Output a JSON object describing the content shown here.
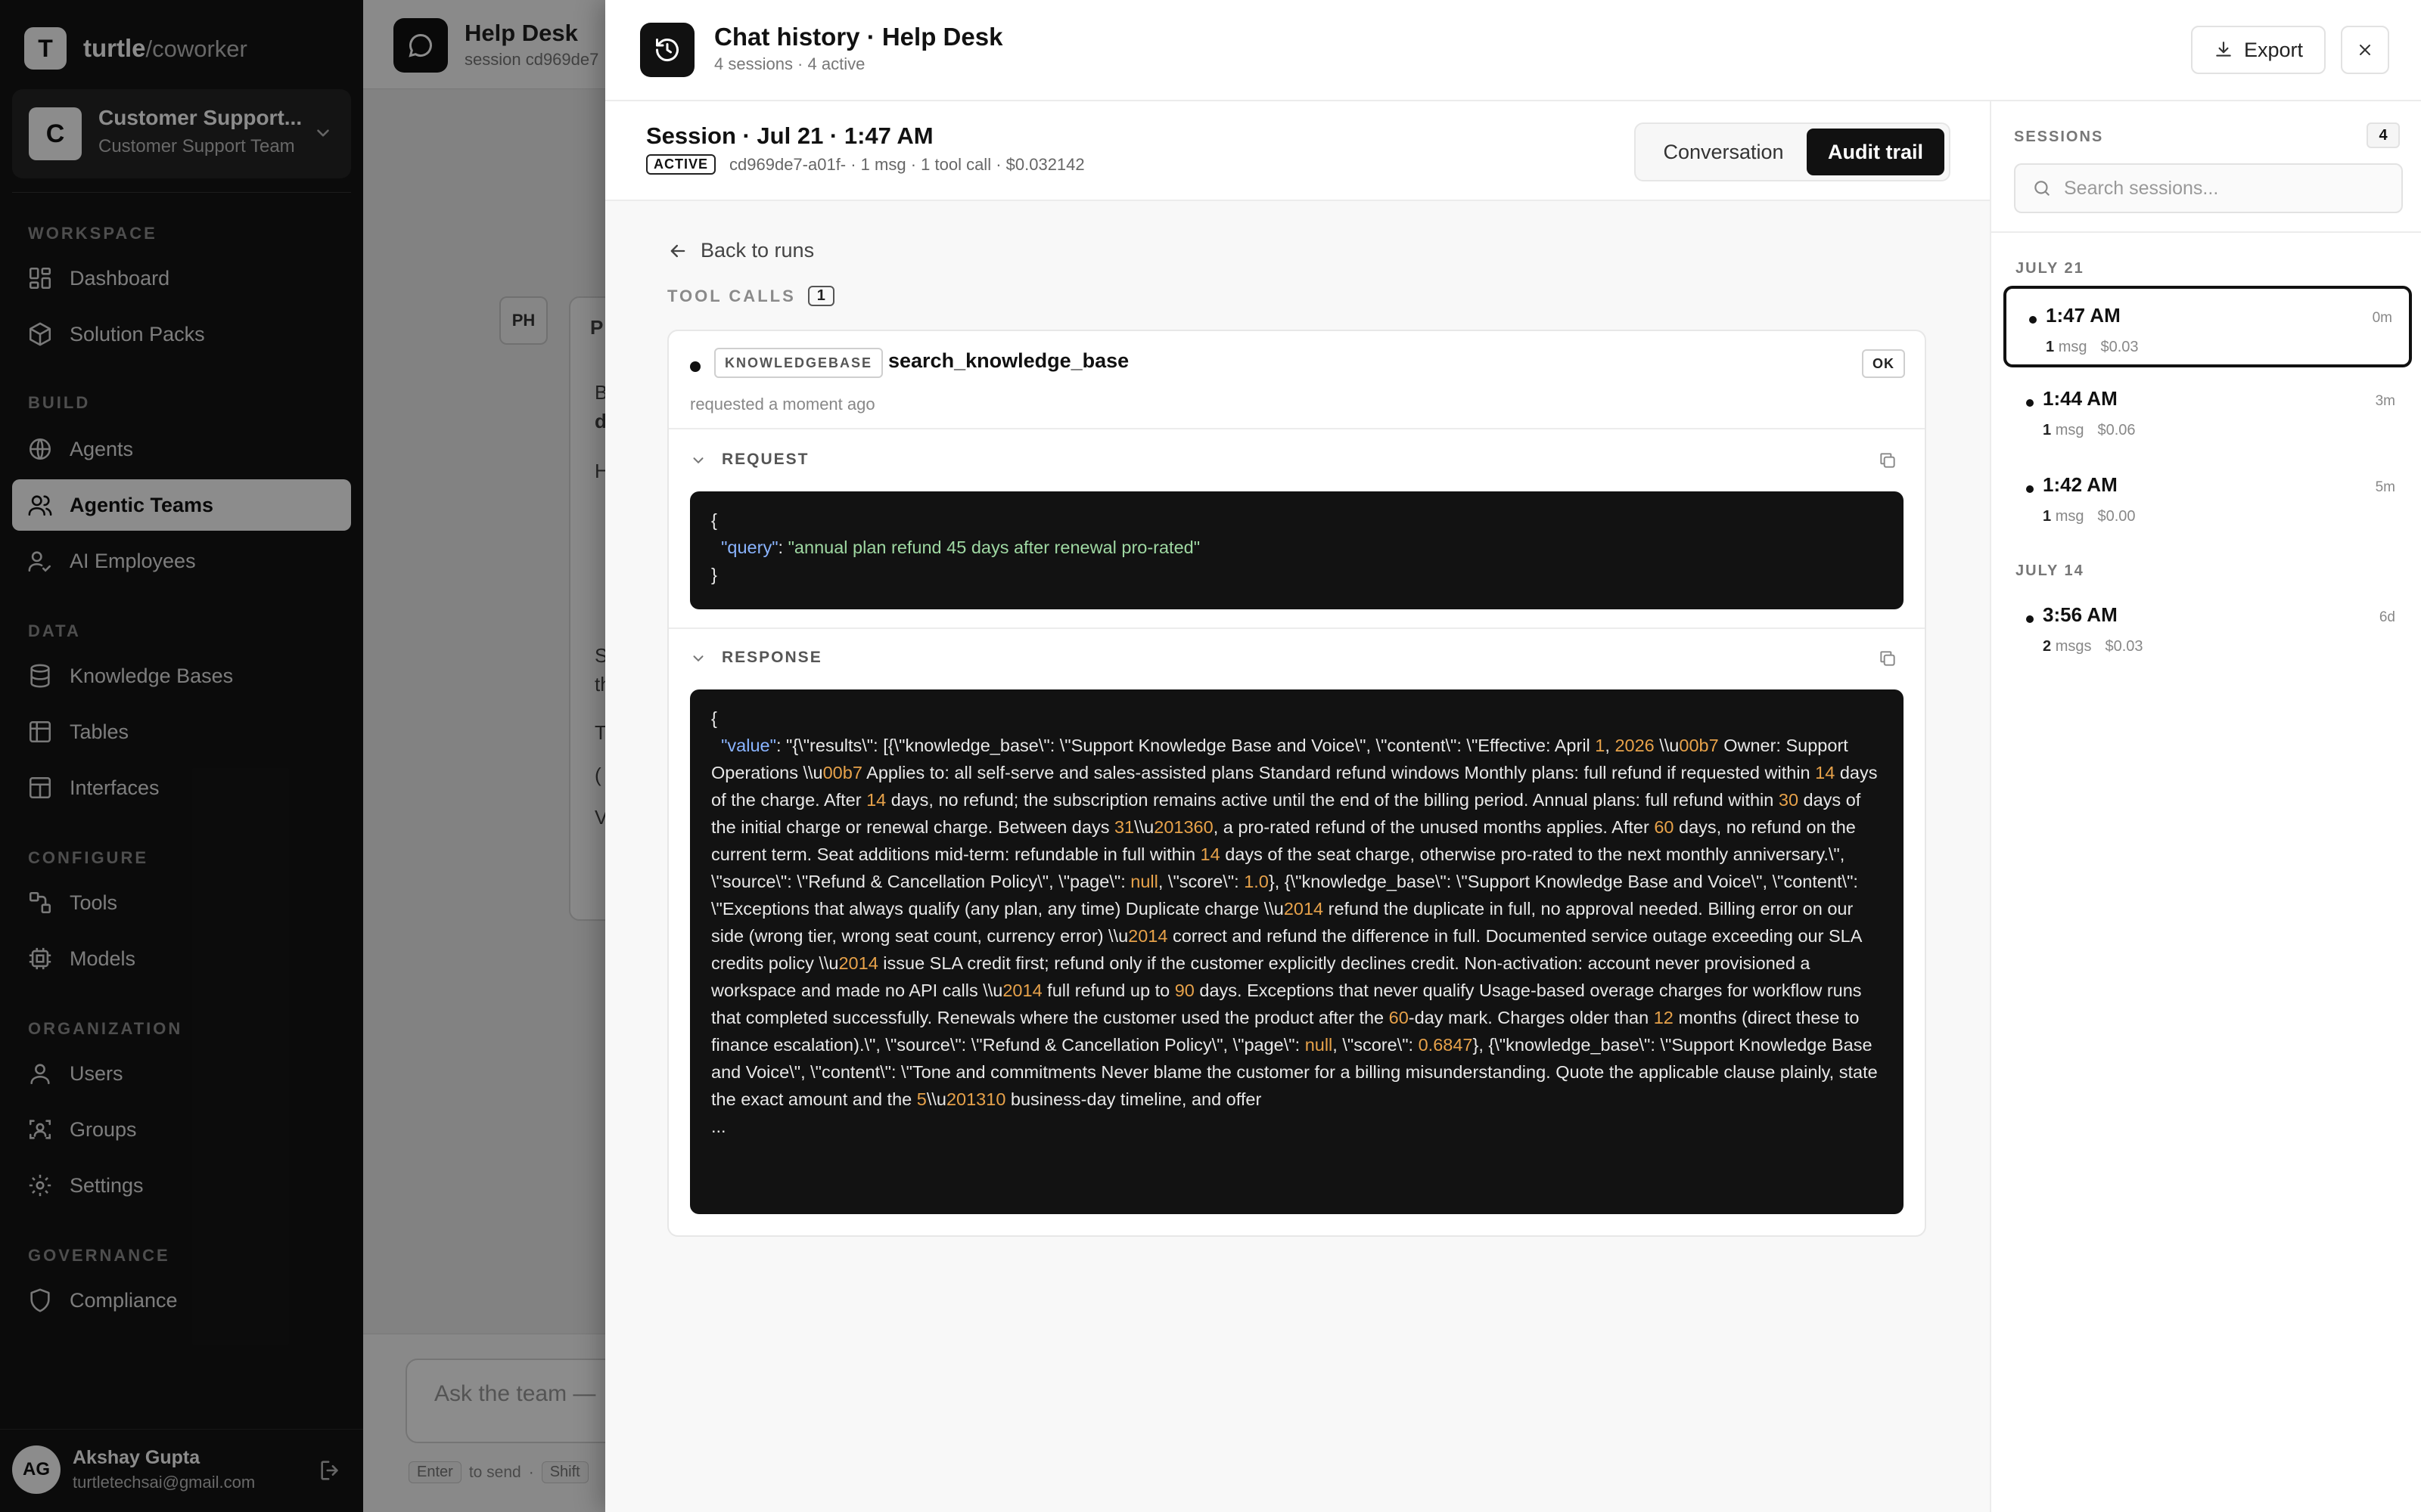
{
  "sidebar": {
    "brand": "turtle",
    "brand_suffix": "/coworker",
    "brand_letter": "T",
    "team": {
      "avatar": "C",
      "name": "Customer Support...",
      "subtitle": "Customer Support Team"
    },
    "sections": {
      "workspace": "WORKSPACE",
      "build": "BUILD",
      "data": "DATA",
      "configure": "CONFIGURE",
      "organization": "ORGANIZATION",
      "governance": "GOVERNANCE"
    },
    "items": {
      "dashboard": "Dashboard",
      "solution_packs": "Solution Packs",
      "agents": "Agents",
      "agentic_teams": "Agentic Teams",
      "ai_employees": "AI Employees",
      "knowledge_bases": "Knowledge Bases",
      "tables": "Tables",
      "interfaces": "Interfaces",
      "tools": "Tools",
      "models": "Models",
      "users": "Users",
      "groups": "Groups",
      "settings": "Settings",
      "compliance": "Compliance"
    },
    "user": {
      "initials": "AG",
      "name": "Akshay Gupta",
      "email": "turtletechsai@gmail.com"
    }
  },
  "background": {
    "title": "Help Desk",
    "subtitle": "session cd969de7",
    "ph": "PH",
    "card_letters": [
      "P",
      "B",
      "d",
      "H",
      "S",
      "th",
      "T",
      "(",
      "V"
    ],
    "input_placeholder": "Ask the team —",
    "hint_key": "Enter",
    "hint_text": "to send",
    "hint_sep": "·",
    "hint_key2": "Shift"
  },
  "drawer": {
    "title": "Chat history · Help Desk",
    "subtitle": "4 sessions · 4 active",
    "export_label": "Export"
  },
  "session": {
    "title": "Session · Jul 21 · 1:47 AM",
    "status": "ACTIVE",
    "meta": "cd969de7-a01f- · 1 msg · 1 tool call · $0.032142",
    "tabs": {
      "conversation": "Conversation",
      "audit": "Audit trail"
    }
  },
  "audit": {
    "back": "Back to runs",
    "tool_calls_label": "TOOL CALLS",
    "tool_calls_count": "1",
    "call": {
      "kind": "KNOWLEDGEBASE",
      "name": "search_knowledge_base",
      "status": "OK",
      "time": "requested a moment ago"
    },
    "request_label": "REQUEST",
    "response_label": "RESPONSE",
    "request": {
      "open": "{",
      "key": "\"query\"",
      "value": "\"annual plan refund 45 days after renewal pro-rated\"",
      "close": "}"
    },
    "response": {
      "open": "{",
      "key": "\"value\"",
      "segments": [
        ": \"{\\\"results\\\": [{\\\"knowledge_base\\\": \\\"Support Knowledge Base and Voice\\\", \\\"content\\\": \\\"Effective: April ",
        "1",
        ", ",
        "2026",
        " \\\\u",
        "00",
        "b",
        "7",
        " Owner: Support Operations \\\\u",
        "00",
        "b",
        "7",
        " Applies to: all self-serve and sales-assisted plans Standard refund windows Monthly plans: full refund if requested within ",
        "14",
        " days of the charge. After ",
        "14",
        " days, no refund; the subscription remains active until the end of the billing period. Annual plans: full refund within ",
        "30",
        " days of the initial charge or renewal charge. Between days ",
        "31",
        "\\\\u",
        "201360",
        ", a pro-rated refund of the unused months applies. After ",
        "60",
        " days, no refund on the current term. Seat additions mid-term: refundable in full within ",
        "14",
        " days of the seat charge, otherwise pro-rated to the next monthly anniversary.\\\", \\\"source\\\": \\\"Refund & Cancellation Policy\\\", \\\"page\\\": ",
        "null",
        ", \\\"score\\\": ",
        "1.0",
        "}, {\\\"knowledge_base\\\": \\\"Support Knowledge Base and Voice\\\", \\\"content\\\": \\\"Exceptions that always qualify (any plan, any time) Duplicate charge \\\\u",
        "2014",
        " refund the duplicate in full, no approval needed. Billing error on our side (wrong tier, wrong seat count, currency error) \\\\u",
        "2014",
        " correct and refund the difference in full. Documented service outage exceeding our SLA credits policy \\\\u",
        "2014",
        " issue SLA credit first; refund only if the customer explicitly declines credit. Non-activation: account never provisioned a workspace and made no API calls \\\\u",
        "2014",
        " full refund up to ",
        "90",
        " days. Exceptions that never qualify Usage-based overage charges for workflow runs that completed successfully. Renewals where the customer used the product after the ",
        "60",
        "-day mark. Charges older than ",
        "12",
        " months (direct these to finance escalation).\\\", \\\"source\\\": \\\"Refund & Cancellation Policy\\\", \\\"page\\\": ",
        "null",
        ", \\\"score\\\": ",
        "0.6847",
        "}, {\\\"knowledge_base\\\": \\\"Support Knowledge Base and Voice\\\", \\\"content\\\": \\\"Tone and commitments Never blame the customer for a billing misunderstanding. Quote the applicable clause plainly, state the exact amount and the ",
        "5",
        "\\\\u",
        "201310",
        " business-day timeline, and offer"
      ],
      "ellipsis": "..."
    }
  },
  "sessions": {
    "label": "SESSIONS",
    "count": "4",
    "search_placeholder": "Search sessions...",
    "groups": [
      {
        "label": "JULY 21",
        "items": [
          {
            "time": "1:47 AM",
            "ago": "0m",
            "msgs": "1",
            "msg_word": "msg",
            "cost": "$0.03",
            "selected": true
          },
          {
            "time": "1:44 AM",
            "ago": "3m",
            "msgs": "1",
            "msg_word": "msg",
            "cost": "$0.06",
            "selected": false
          },
          {
            "time": "1:42 AM",
            "ago": "5m",
            "msgs": "1",
            "msg_word": "msg",
            "cost": "$0.00",
            "selected": false
          }
        ]
      },
      {
        "label": "JULY 14",
        "items": [
          {
            "time": "3:56 AM",
            "ago": "6d",
            "msgs": "2",
            "msg_word": "msgs",
            "cost": "$0.03",
            "selected": false
          }
        ]
      }
    ]
  }
}
